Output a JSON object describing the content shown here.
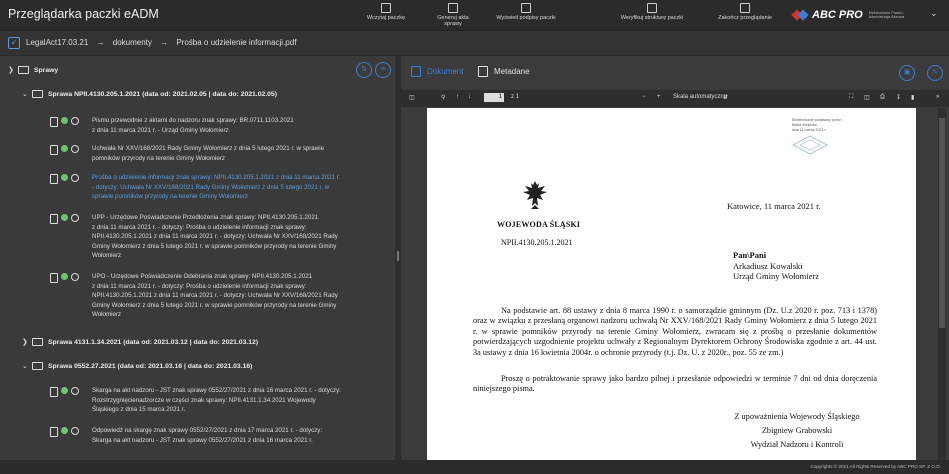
{
  "app": {
    "title": "Przeglądarka paczki eADM",
    "toolbar": [
      {
        "label": "Wczytaj paczkę",
        "icon": "load-icon"
      },
      {
        "label": "Generuj akta sprawy",
        "icon": "generate-icon"
      },
      {
        "label": "Wyświetl podpisy paczki",
        "icon": "signature-icon"
      },
      {
        "label": "Weryfikuj strukturę paczki",
        "icon": "verify-icon"
      },
      {
        "label": "Zakończ przeglądanie",
        "icon": "close-icon"
      }
    ],
    "logo": {
      "text": "ABC PRO",
      "subtitle": "Elektroniczne Prawo i Administracja Biurowa"
    },
    "colors": {
      "accent": "#3e7fcf",
      "selected": "#5e9fe0",
      "ok": "#6ec36e"
    }
  },
  "breadcrumb": [
    "LegalAct17.03.21",
    "dokumenty",
    "Prośba o udzielenie informacji.pdf"
  ],
  "tree": {
    "root": "Sprawy",
    "cases": [
      {
        "title": "Sprawa NPII.4130.205.1.2021 (data od: 2021.02.05 | data do: 2021.02.05)",
        "docs": [
          {
            "lines": [
              "Pismo przewodnie z aktami do nadzoru znak sprawy: BR.0711.1103.2021",
              "z dnia 11 marca 2021 r. - Urząd Gminy Wołomierz"
            ]
          },
          {
            "lines": [
              "Uchwała Nr XXV/168/2021 Rady Gminy Wołomierz z dnia 5 lutego 2021 r. w sprawie",
              "pomników przyrody na terenie Gminy Wołomierz"
            ]
          },
          {
            "lines": [
              "Prośba o udzielenie informacji znak sprawy: NPII.4130.205.1.2021 z dnia 11 marca 2021 r.",
              "- dotyczy: Uchwała Nr XXV/168/2021 Rady Gminy Wołomierz z dnia 5 lutego 2021 r. w",
              "sprawie pomników przyrody na terenie Gminy Wołomierz"
            ],
            "selected": true
          },
          {
            "lines": [
              "UPP - Urzędowe Poświadczenie Przedłożenia znak sprawy: NPII.4130.205.1.2021",
              "z dnia 11 marca 2021 r. - dotyczy: Prośba o udzielenie informacji znak sprawy:",
              "NPII.4130.205.1.2021 z dnia 11 marca 2021 r. - dotyczy: Uchwała Nr XXV/168/2021 Rady",
              "Gminy Wołomierz z dnia 5 lutego 2021 r. w sprawie pomników przyrody na terenie Gminy",
              "Wołomierz"
            ]
          },
          {
            "lines": [
              "UPO - Urzędowe Poświadczenie Odebrania znak sprawy: NPII.4130.205.1.2021",
              "z dnia 11 marca 2021 r. - dotyczy: Prośba o udzielenie informacji znak sprawy:",
              "NPII.4130.205.1.2021 z dnia 11 marca 2021 r. - dotyczy: Uchwała Nr XXV/168/2021 Rady",
              "Gminy Wołomierz z dnia 5 lutego 2021 r. w sprawie pomników przyrody na terenie Gminy",
              "Wołomierz"
            ]
          }
        ]
      },
      {
        "title": "Sprawa 4131.1.34.2021 (data od: 2021.03.12 | data do: 2021.03.12)",
        "docs": []
      },
      {
        "title": "Sprawa 0552.27.2021 (data od: 2021.03.16 | data do: 2021.03.16)",
        "docs": [
          {
            "lines": [
              "Skarga na akt nadzoru - JST znak sprawy 0552/27/2021 z dnia 16 marca 2021 r. - dotyczy:",
              "Rozstrzygnięcienadzorcze w części znak sprawy: NPII.4131.1.34.2021 Wojewody",
              "Śląskiego z dnia 15 marca 2021 r."
            ]
          },
          {
            "lines": [
              "Odpowiedź na skargę znak sprawy 0552/27/2021 z dnia 17 marca 2021 r. - dotyczy:",
              "Skarga na akt nadzoru - JST znak sprawy 0552/27/2021 z dnia 16 marca 2021 r."
            ]
          }
        ]
      }
    ]
  },
  "viewer": {
    "tabs": [
      "Dokument",
      "Metadane"
    ],
    "page_current": "1",
    "page_total": "z 1",
    "zoom": "Skala automatyczna"
  },
  "letter": {
    "stamp": [
      "Elektroniczne podpisany przez:",
      "Beata Wojcicka",
      "dnia 11 marca 2021 r."
    ],
    "place_date": "Katowice, 11 marca 2021 r.",
    "issuer": "WOJEWODA ŚLĄSKI",
    "ref": "NPII.4130.205.1.2021",
    "addressee": [
      "Pan\\Pani",
      "Arkadiusz Kowalski",
      "Urząd Gminy Wołomierz"
    ],
    "body1": "Na podstawie art. 88 ustawy z dnia 8 marca 1990 r. o samorządzie gminnym (Dz. U.z 2020 r. poz. 713 i 1378) oraz w związku z przesłaną organowi nadzoru uchwałą Nr XXV/168/2021 Rady Gminy Wołomierz z dnia 5 lutego 2021 r. w sprawie pomników przyrody na terenie Gminy Wołomierz, zwracam się z prośbą o przesłanie dokumentów potwierdzających uzgodnienie projektu uchwały z Regionalnym Dyrektorem Ochrony Środowiska zgodnie z art. 44 ust. 3a ustawy z dnia 16 kwietnia 2004r. o ochronie przyrody (t.j. Dz. U. z 2020r., poz. 55 ze zm.)",
    "body2": "Proszę o potraktowanie sprawy jako bardzo pilnej i przesłanie odpowiedzi w terminie 7 dni od dnia doręczenia niniejszego pisma.",
    "signature": [
      "Z upoważnienia Wojewody Śląskiego",
      "Zbigniew Grabowski",
      "Wydział Nadzoru i Kontroli"
    ]
  },
  "footer": "Copyrights © 2021 All Rights Reserved by ABC PRO SP. Z O.O."
}
